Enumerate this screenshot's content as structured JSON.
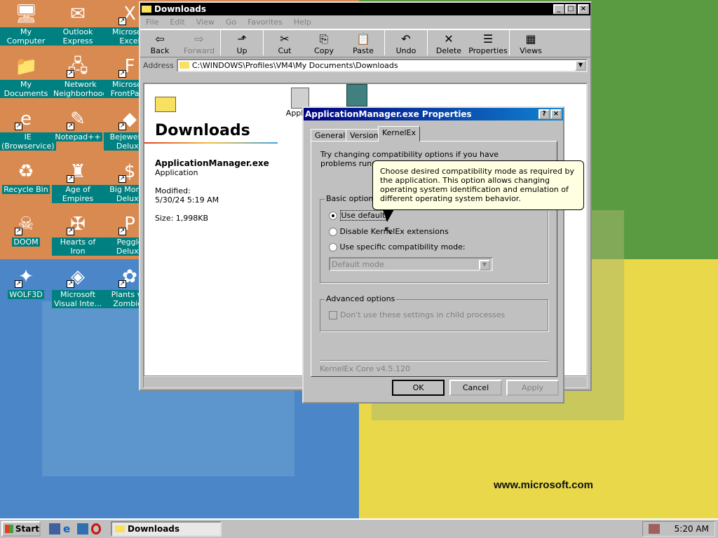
{
  "desktop": {
    "icons": [
      {
        "label": "My Computer",
        "glyph": "🖥"
      },
      {
        "label": "Outlook Express",
        "glyph": "✉"
      },
      {
        "label": "Microsoft Excel",
        "glyph": "X"
      },
      {
        "label": "My Documents",
        "glyph": "📁"
      },
      {
        "label": "Network Neighborhood",
        "glyph": "🖧"
      },
      {
        "label": "Microsoft FrontPage",
        "glyph": "F"
      },
      {
        "label": "IE (Browservice)",
        "glyph": "e"
      },
      {
        "label": "Notepad++",
        "glyph": "✎"
      },
      {
        "label": "Bejeweled Deluxe",
        "glyph": "◆"
      },
      {
        "label": "Recycle Bin",
        "glyph": "♻"
      },
      {
        "label": "Age of Empires",
        "glyph": "♜"
      },
      {
        "label": "Big Money Deluxe",
        "glyph": "$"
      },
      {
        "label": "DOOM",
        "glyph": "☠"
      },
      {
        "label": "Hearts of Iron",
        "glyph": "✠"
      },
      {
        "label": "Peggle Deluxe",
        "glyph": "P"
      },
      {
        "label": "WOLF3D",
        "glyph": "✦"
      },
      {
        "label": "Microsoft Visual Inte...",
        "glyph": "◈"
      },
      {
        "label": "Plants vs. Zombies",
        "glyph": "✿"
      }
    ],
    "watermark": "www.microsoft.com"
  },
  "explorer": {
    "title": "Downloads",
    "menu": [
      "File",
      "Edit",
      "View",
      "Go",
      "Favorites",
      "Help"
    ],
    "toolbar": [
      {
        "label": "Back",
        "icon": "⇦"
      },
      {
        "label": "Forward",
        "icon": "⇨"
      },
      {
        "label": "Up",
        "icon": "⬏"
      },
      {
        "label": "Cut",
        "icon": "✂"
      },
      {
        "label": "Copy",
        "icon": "⎘"
      },
      {
        "label": "Paste",
        "icon": "📋"
      },
      {
        "label": "Undo",
        "icon": "↶"
      },
      {
        "label": "Delete",
        "icon": "✕"
      },
      {
        "label": "Properties",
        "icon": "☰"
      },
      {
        "label": "Views",
        "icon": "▦"
      }
    ],
    "address_label": "Address",
    "address": "C:\\WINDOWS\\Profiles\\VM4\\My Documents\\Downloads",
    "folder_name": "Downloads",
    "file_name": "ApplicationManager.exe",
    "file_type": "Application",
    "modified_label": "Modified:",
    "modified": "5/30/24 5:19 AM",
    "size": "Size: 1,998KB",
    "item_label": "Applica"
  },
  "dialog": {
    "title": "ApplicationManager.exe Properties",
    "tabs": [
      "General",
      "Version",
      "KernelEx"
    ],
    "intro": "Try changing compatibility options if you have problems running the program.",
    "basic_label": "Basic options",
    "opt1": "Use default",
    "opt2": "Disable KernelEx extensions",
    "opt3": "Use specific compatibility mode:",
    "mode": "Default mode",
    "advanced_label": "Advanced options",
    "adv_check": "Don't use these settings in child processes",
    "footer": "KernelEx Core v4.5.120",
    "ok": "OK",
    "cancel": "Cancel",
    "apply": "Apply"
  },
  "tooltip": "Choose desired compatibility mode as required by the application. This option allows changing operating system identification and emulation of different operating system behavior.",
  "taskbar": {
    "start": "Start",
    "task": "Downloads",
    "time": "5:20 AM"
  }
}
